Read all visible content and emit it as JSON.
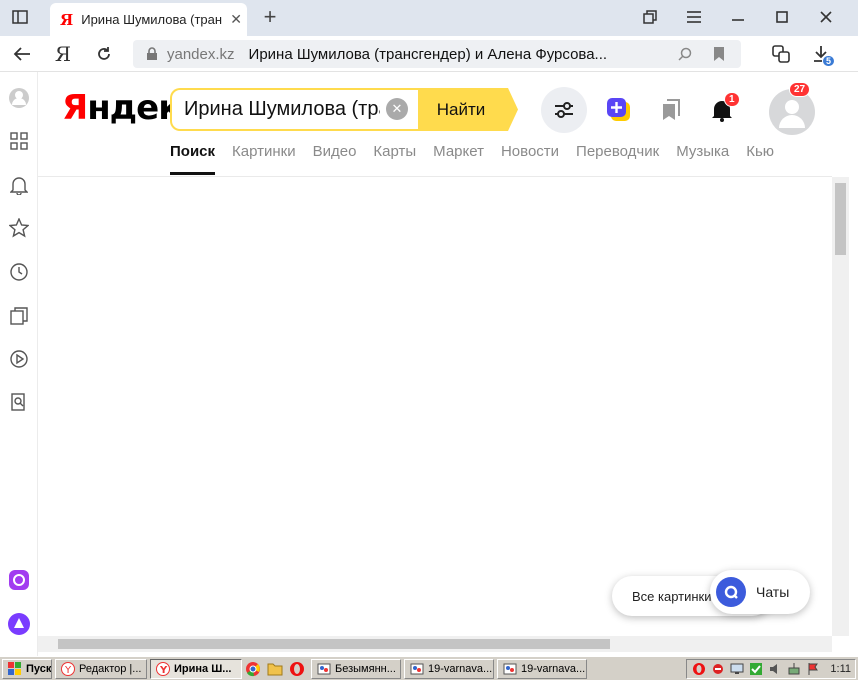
{
  "browser": {
    "tab_title": "Ирина Шумилова (тран",
    "tab_favicon": "Я",
    "domain": "yandex.kz",
    "page_title": "Ирина Шумилова (трансгендер) и Алена Фурсова...",
    "download_count": "5"
  },
  "header": {
    "logo_first": "Я",
    "logo_rest": "ндекс",
    "search_value": "Ирина Шумилова (тра",
    "search_button": "Найти",
    "notif_count": "1",
    "profile_count": "27"
  },
  "services": [
    {
      "label": "Поиск",
      "active": true
    },
    {
      "label": "Картинки",
      "active": false
    },
    {
      "label": "Видео",
      "active": false
    },
    {
      "label": "Карты",
      "active": false
    },
    {
      "label": "Маркет",
      "active": false
    },
    {
      "label": "Новости",
      "active": false
    },
    {
      "label": "Переводчик",
      "active": false
    },
    {
      "label": "Музыка",
      "active": false
    },
    {
      "label": "Кью",
      "active": false
    }
  ],
  "floating": {
    "all_pictures": "Все картинки",
    "chats": "Чаты"
  },
  "taskbar": {
    "start": "Пуск",
    "items": [
      {
        "label": "Редактор |...",
        "icon": "yandex-icon"
      },
      {
        "label": "Ирина Ш...",
        "icon": "yandex-icon",
        "pressed": true
      },
      {
        "label": "Безымянн...",
        "icon": "paint-icon"
      },
      {
        "label": "19-varnava...",
        "icon": "paint-icon"
      },
      {
        "label": "19-varnava...",
        "icon": "paint-icon"
      }
    ],
    "clock": "1:11"
  },
  "colors": {
    "accent_yellow": "#ffdb4d",
    "brand_red": "#ff0000",
    "alice_purple": "#7a3cff"
  }
}
